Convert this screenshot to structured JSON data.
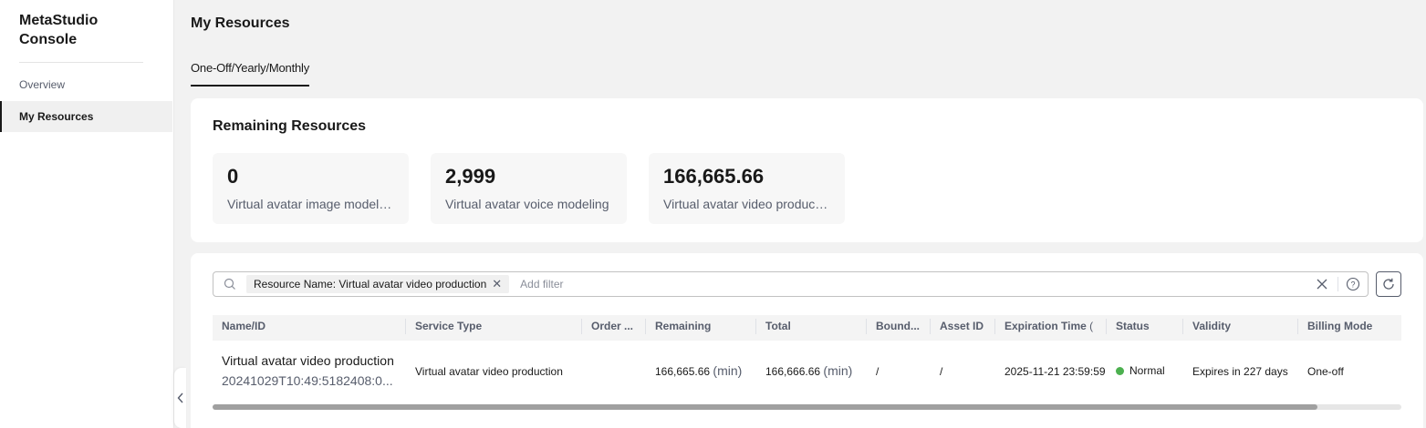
{
  "sidebar": {
    "brand": "MetaStudio Console",
    "items": [
      {
        "label": "Overview"
      },
      {
        "label": "My Resources"
      }
    ],
    "collapse_icon": "chevron-left-icon"
  },
  "page": {
    "title": "My Resources",
    "tab": "One-Off/Yearly/Monthly"
  },
  "remaining": {
    "title": "Remaining Resources",
    "stats": [
      {
        "value": "0",
        "label": "Virtual avatar image modeling"
      },
      {
        "value": "2,999",
        "label": "Virtual avatar voice modeling"
      },
      {
        "value": "166,665.66",
        "label": "Virtual avatar video production"
      }
    ]
  },
  "search": {
    "filter_tag": "Resource Name: Virtual avatar video production",
    "placeholder": "Add filter"
  },
  "table": {
    "columns": [
      "Name/ID",
      "Service Type",
      "Order ...",
      "Remaining",
      "Total",
      "Bound...",
      "Asset ID",
      "Expiration Time",
      "Status",
      "Validity",
      "Billing Mode"
    ],
    "rows": [
      {
        "name": "Virtual avatar video production",
        "id": "20241029T10:49:5182408:0...",
        "service_type": "Virtual avatar video production",
        "order": "",
        "remaining": "166,665.66",
        "remaining_unit": "(min)",
        "total": "166,666.66",
        "total_unit": "(min)",
        "bound": "/",
        "asset_id": "/",
        "expiration": "2025-11-21 23:59:59",
        "status": "Normal",
        "validity": "Expires in 227 days",
        "billing_mode": "One-off"
      }
    ],
    "status_color": "#4cb04f"
  }
}
